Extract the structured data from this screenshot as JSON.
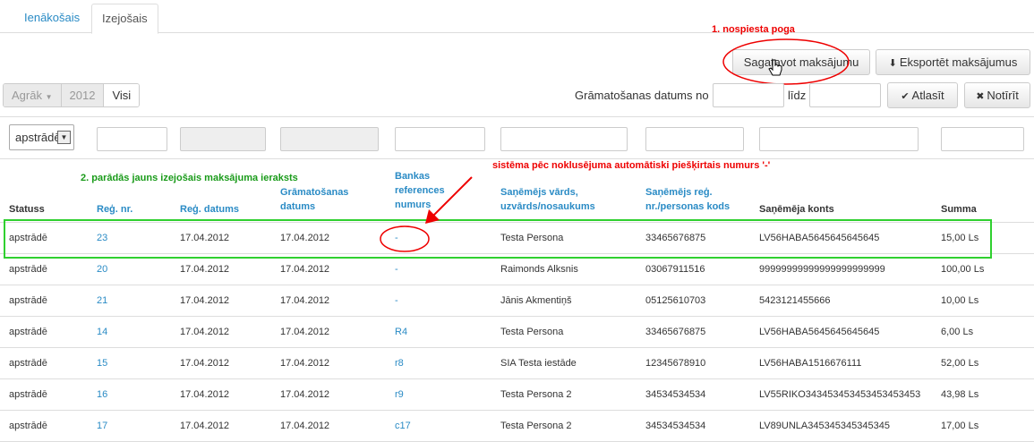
{
  "tabs": [
    {
      "label": "Ienākošais"
    },
    {
      "label": "Izejošais"
    }
  ],
  "toolbar": {
    "prepare_label": "Sagatavot maksājumu",
    "export_label": "Eksportēt maksājumus"
  },
  "annotations": {
    "step1": "1. nospiesta poga",
    "step2": "2. parādās jauns izejošais maksājuma ieraksts",
    "system_note": "sistēma pēc noklusējuma automātiski piešķirtais numurs '-'"
  },
  "period": {
    "earlier": "Agrāk",
    "year": "2012",
    "all": "Visi"
  },
  "date_filter": {
    "label_from": "Grāmatošanas datums no",
    "label_to": "līdz",
    "apply_label": "Atlasīt",
    "clear_label": "Notīrīt"
  },
  "status_filter": {
    "selected": "apstrādē"
  },
  "columns": [
    "Statuss",
    "Reģ. nr.",
    "Reģ. datums",
    "Grāmatošanas datums",
    "Bankas references numurs",
    "Saņēmējs vārds, uzvārds/nosaukums",
    "Saņēmējs reģ. nr./personas kods",
    "Saņēmēja konts",
    "Summa"
  ],
  "rows": [
    {
      "status": "apstrādē",
      "reg": "23",
      "reg_date": "17.04.2012",
      "post_date": "17.04.2012",
      "bank_ref": "-",
      "name": "Testa Persona",
      "code": "33465676875",
      "account": "LV56HABA5645645645645",
      "sum": "15,00 Ls"
    },
    {
      "status": "apstrādē",
      "reg": "20",
      "reg_date": "17.04.2012",
      "post_date": "17.04.2012",
      "bank_ref": "-",
      "name": "Raimonds Alksnis",
      "code": "03067911516",
      "account": "99999999999999999999999",
      "sum": "100,00 Ls"
    },
    {
      "status": "apstrādē",
      "reg": "21",
      "reg_date": "17.04.2012",
      "post_date": "17.04.2012",
      "bank_ref": "-",
      "name": "Jānis Akmentiņš",
      "code": "05125610703",
      "account": "5423121455666",
      "sum": "10,00 Ls"
    },
    {
      "status": "apstrādē",
      "reg": "14",
      "reg_date": "17.04.2012",
      "post_date": "17.04.2012",
      "bank_ref": "R4",
      "name": "Testa Persona",
      "code": "33465676875",
      "account": "LV56HABA5645645645645",
      "sum": "6,00 Ls"
    },
    {
      "status": "apstrādē",
      "reg": "15",
      "reg_date": "17.04.2012",
      "post_date": "17.04.2012",
      "bank_ref": "r8",
      "name": "SIA Testa iestāde",
      "code": "12345678910",
      "account": "LV56HABA1516676111",
      "sum": "52,00 Ls"
    },
    {
      "status": "apstrādē",
      "reg": "16",
      "reg_date": "17.04.2012",
      "post_date": "17.04.2012",
      "bank_ref": "r9",
      "name": "Testa Persona 2",
      "code": "34534534534",
      "account": "LV55RIKO343453453453453453453",
      "sum": "43,98 Ls"
    },
    {
      "status": "apstrādē",
      "reg": "17",
      "reg_date": "17.04.2012",
      "post_date": "17.04.2012",
      "bank_ref": "c17",
      "name": "Testa Persona 2",
      "code": "34534534534",
      "account": "LV89UNLA345345345345345",
      "sum": "17,00 Ls"
    }
  ],
  "colors": {
    "link": "#2a8bc5",
    "annotation_red": "#ee0000",
    "annotation_green": "#1a9b1a",
    "highlight": "#2fd02f"
  }
}
